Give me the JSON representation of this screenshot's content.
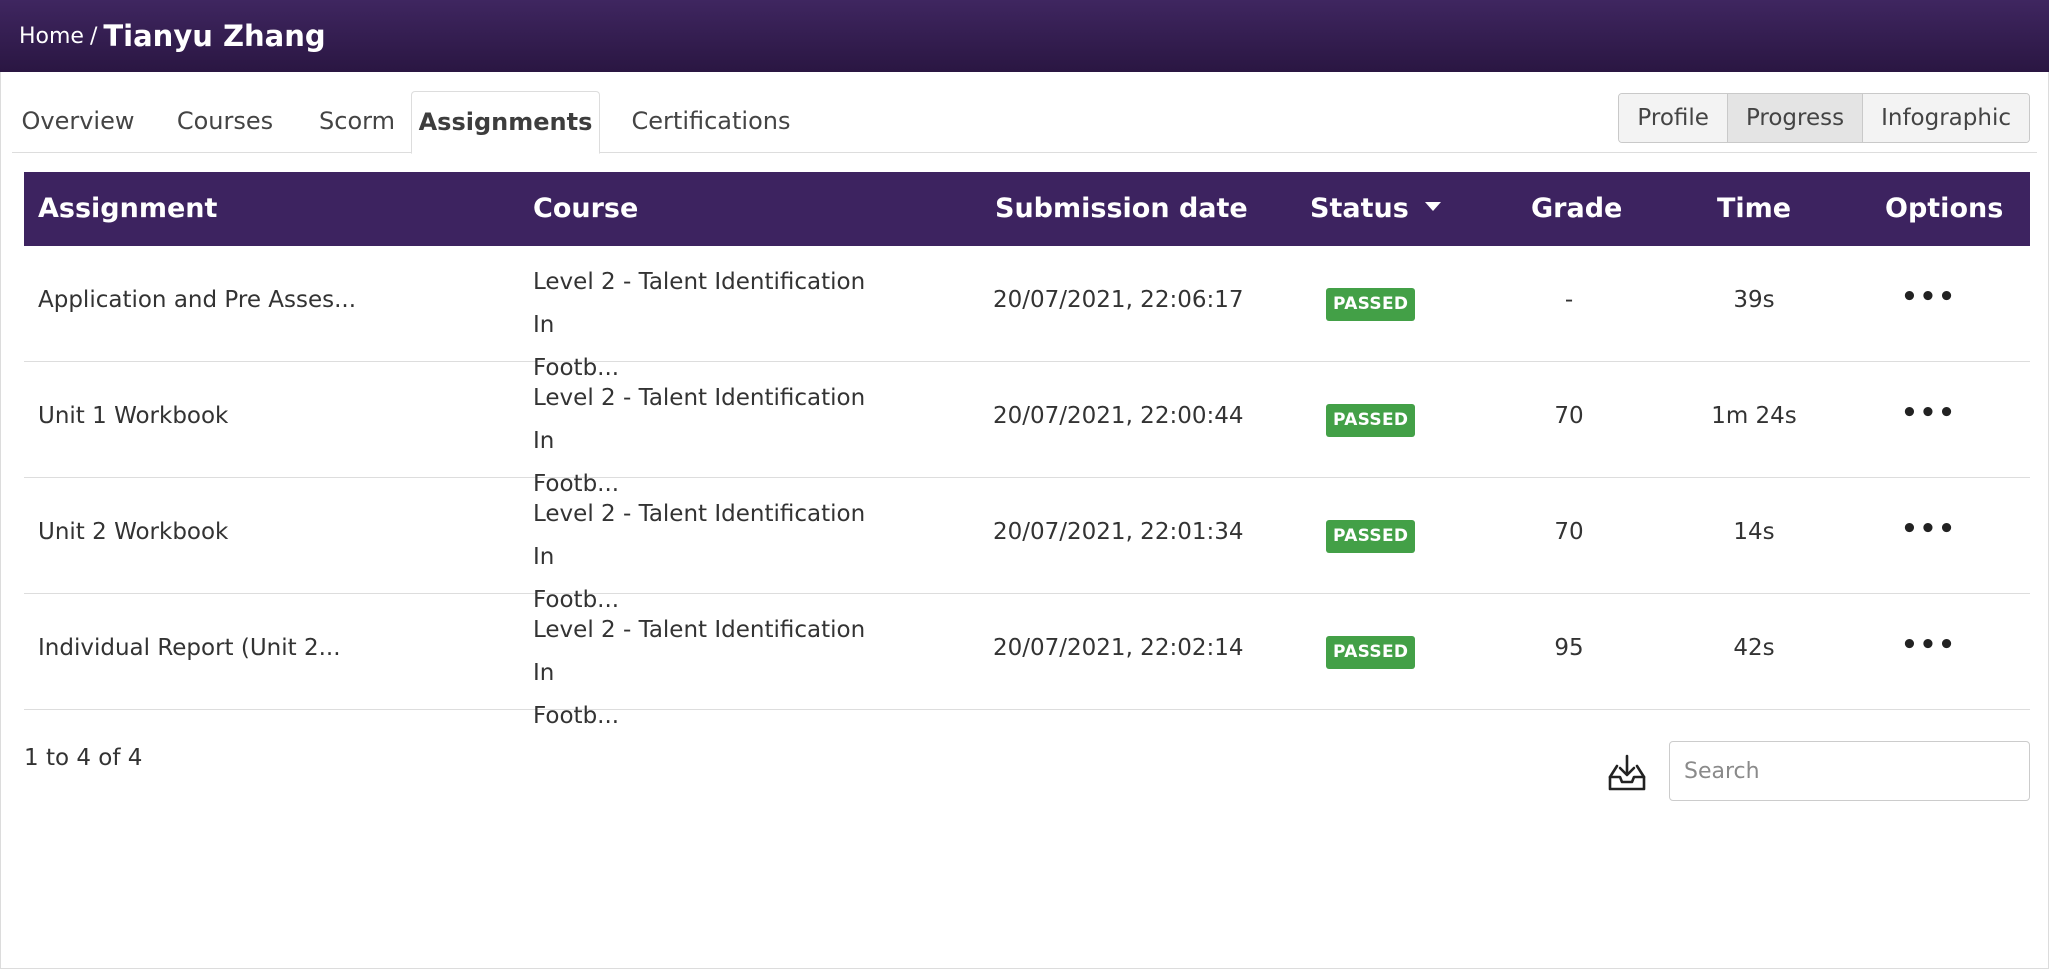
{
  "breadcrumb": {
    "home": "Home",
    "separator": "/",
    "current": "Tianyu Zhang"
  },
  "tabs": [
    {
      "label": "Overview",
      "active": false
    },
    {
      "label": "Courses",
      "active": false
    },
    {
      "label": "Scorm",
      "active": false
    },
    {
      "label": "Assignments",
      "active": true
    },
    {
      "label": "Certifications",
      "active": false
    }
  ],
  "view_buttons": [
    {
      "label": "Profile",
      "active": false
    },
    {
      "label": "Progress",
      "active": true
    },
    {
      "label": "Infographic",
      "active": false
    }
  ],
  "table": {
    "columns": {
      "assignment": "Assignment",
      "course": "Course",
      "submission_date": "Submission date",
      "status": "Status",
      "grade": "Grade",
      "time": "Time",
      "options": "Options"
    },
    "sorted_by": "Status",
    "rows": [
      {
        "assignment": "Application and Pre Asses...",
        "course_line1": "Level 2 - Talent Identification In",
        "course_line2": "Footb...",
        "submission_date": "20/07/2021, 22:06:17",
        "status": "PASSED",
        "grade": "-",
        "time": "39s",
        "options": "•••"
      },
      {
        "assignment": "Unit 1 Workbook",
        "course_line1": "Level 2 - Talent Identification In",
        "course_line2": "Footb...",
        "submission_date": "20/07/2021, 22:00:44",
        "status": "PASSED",
        "grade": "70",
        "time": "1m 24s",
        "options": "•••"
      },
      {
        "assignment": "Unit 2 Workbook",
        "course_line1": "Level 2 - Talent Identification In",
        "course_line2": "Footb...",
        "submission_date": "20/07/2021, 22:01:34",
        "status": "PASSED",
        "grade": "70",
        "time": "14s",
        "options": "•••"
      },
      {
        "assignment": "Individual Report (Unit 2...",
        "course_line1": "Level 2 - Talent Identification In",
        "course_line2": "Footb...",
        "submission_date": "20/07/2021, 22:02:14",
        "status": "PASSED",
        "grade": "95",
        "time": "42s",
        "options": "•••"
      }
    ]
  },
  "footer": {
    "pager": "1 to 4 of 4",
    "download_icon": "download-tray-icon",
    "search_placeholder": "Search"
  },
  "colors": {
    "header_bg": "#3d2360",
    "passed_badge": "#43a047"
  }
}
